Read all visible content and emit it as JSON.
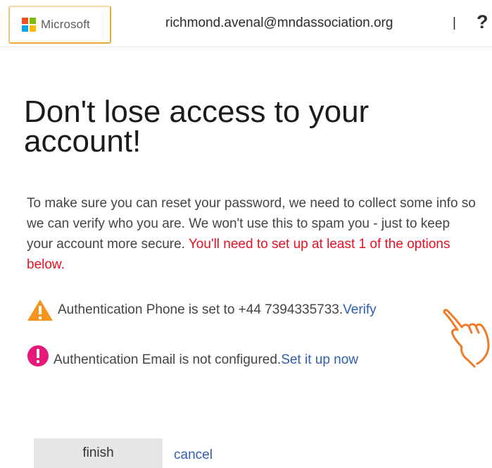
{
  "header": {
    "logo_text": "Microsoft",
    "user_email": "richmond.avenal@mndassociation.org",
    "divider": "|",
    "help_label": "?"
  },
  "title": "Don't lose access to your account!",
  "description": {
    "text": "To make sure you can reset your password, we need to collect some info so we can verify who you are. We won't use this to spam you - just to keep your account more secure. ",
    "required_text": "You'll need to set up at least 1 of the options below."
  },
  "phone_status": {
    "icon": "warning-icon",
    "icon_color": "#f7941d",
    "text": "Authentication Phone is set to +44 7394335733. ",
    "link": "Verify"
  },
  "email_status": {
    "icon": "error-icon",
    "icon_color": "#e4197a",
    "text": "Authentication Email is not configured. ",
    "link": "Set it up now"
  },
  "actions": {
    "finish_label": "finish",
    "cancel_label": "cancel"
  },
  "colors": {
    "link": "#2e5fae",
    "required": "#e81123",
    "logo_border": "#e9a93a",
    "pointer_hand": "#ef7b2a"
  }
}
